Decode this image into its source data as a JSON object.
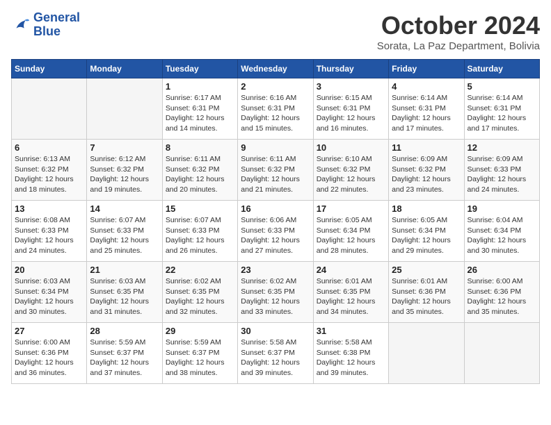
{
  "header": {
    "logo_line1": "General",
    "logo_line2": "Blue",
    "month_title": "October 2024",
    "subtitle": "Sorata, La Paz Department, Bolivia"
  },
  "weekdays": [
    "Sunday",
    "Monday",
    "Tuesday",
    "Wednesday",
    "Thursday",
    "Friday",
    "Saturday"
  ],
  "weeks": [
    [
      {
        "day": "",
        "sunrise": "",
        "sunset": "",
        "daylight": ""
      },
      {
        "day": "",
        "sunrise": "",
        "sunset": "",
        "daylight": ""
      },
      {
        "day": "1",
        "sunrise": "Sunrise: 6:17 AM",
        "sunset": "Sunset: 6:31 PM",
        "daylight": "Daylight: 12 hours and 14 minutes."
      },
      {
        "day": "2",
        "sunrise": "Sunrise: 6:16 AM",
        "sunset": "Sunset: 6:31 PM",
        "daylight": "Daylight: 12 hours and 15 minutes."
      },
      {
        "day": "3",
        "sunrise": "Sunrise: 6:15 AM",
        "sunset": "Sunset: 6:31 PM",
        "daylight": "Daylight: 12 hours and 16 minutes."
      },
      {
        "day": "4",
        "sunrise": "Sunrise: 6:14 AM",
        "sunset": "Sunset: 6:31 PM",
        "daylight": "Daylight: 12 hours and 17 minutes."
      },
      {
        "day": "5",
        "sunrise": "Sunrise: 6:14 AM",
        "sunset": "Sunset: 6:31 PM",
        "daylight": "Daylight: 12 hours and 17 minutes."
      }
    ],
    [
      {
        "day": "6",
        "sunrise": "Sunrise: 6:13 AM",
        "sunset": "Sunset: 6:32 PM",
        "daylight": "Daylight: 12 hours and 18 minutes."
      },
      {
        "day": "7",
        "sunrise": "Sunrise: 6:12 AM",
        "sunset": "Sunset: 6:32 PM",
        "daylight": "Daylight: 12 hours and 19 minutes."
      },
      {
        "day": "8",
        "sunrise": "Sunrise: 6:11 AM",
        "sunset": "Sunset: 6:32 PM",
        "daylight": "Daylight: 12 hours and 20 minutes."
      },
      {
        "day": "9",
        "sunrise": "Sunrise: 6:11 AM",
        "sunset": "Sunset: 6:32 PM",
        "daylight": "Daylight: 12 hours and 21 minutes."
      },
      {
        "day": "10",
        "sunrise": "Sunrise: 6:10 AM",
        "sunset": "Sunset: 6:32 PM",
        "daylight": "Daylight: 12 hours and 22 minutes."
      },
      {
        "day": "11",
        "sunrise": "Sunrise: 6:09 AM",
        "sunset": "Sunset: 6:32 PM",
        "daylight": "Daylight: 12 hours and 23 minutes."
      },
      {
        "day": "12",
        "sunrise": "Sunrise: 6:09 AM",
        "sunset": "Sunset: 6:33 PM",
        "daylight": "Daylight: 12 hours and 24 minutes."
      }
    ],
    [
      {
        "day": "13",
        "sunrise": "Sunrise: 6:08 AM",
        "sunset": "Sunset: 6:33 PM",
        "daylight": "Daylight: 12 hours and 24 minutes."
      },
      {
        "day": "14",
        "sunrise": "Sunrise: 6:07 AM",
        "sunset": "Sunset: 6:33 PM",
        "daylight": "Daylight: 12 hours and 25 minutes."
      },
      {
        "day": "15",
        "sunrise": "Sunrise: 6:07 AM",
        "sunset": "Sunset: 6:33 PM",
        "daylight": "Daylight: 12 hours and 26 minutes."
      },
      {
        "day": "16",
        "sunrise": "Sunrise: 6:06 AM",
        "sunset": "Sunset: 6:33 PM",
        "daylight": "Daylight: 12 hours and 27 minutes."
      },
      {
        "day": "17",
        "sunrise": "Sunrise: 6:05 AM",
        "sunset": "Sunset: 6:34 PM",
        "daylight": "Daylight: 12 hours and 28 minutes."
      },
      {
        "day": "18",
        "sunrise": "Sunrise: 6:05 AM",
        "sunset": "Sunset: 6:34 PM",
        "daylight": "Daylight: 12 hours and 29 minutes."
      },
      {
        "day": "19",
        "sunrise": "Sunrise: 6:04 AM",
        "sunset": "Sunset: 6:34 PM",
        "daylight": "Daylight: 12 hours and 30 minutes."
      }
    ],
    [
      {
        "day": "20",
        "sunrise": "Sunrise: 6:03 AM",
        "sunset": "Sunset: 6:34 PM",
        "daylight": "Daylight: 12 hours and 30 minutes."
      },
      {
        "day": "21",
        "sunrise": "Sunrise: 6:03 AM",
        "sunset": "Sunset: 6:35 PM",
        "daylight": "Daylight: 12 hours and 31 minutes."
      },
      {
        "day": "22",
        "sunrise": "Sunrise: 6:02 AM",
        "sunset": "Sunset: 6:35 PM",
        "daylight": "Daylight: 12 hours and 32 minutes."
      },
      {
        "day": "23",
        "sunrise": "Sunrise: 6:02 AM",
        "sunset": "Sunset: 6:35 PM",
        "daylight": "Daylight: 12 hours and 33 minutes."
      },
      {
        "day": "24",
        "sunrise": "Sunrise: 6:01 AM",
        "sunset": "Sunset: 6:35 PM",
        "daylight": "Daylight: 12 hours and 34 minutes."
      },
      {
        "day": "25",
        "sunrise": "Sunrise: 6:01 AM",
        "sunset": "Sunset: 6:36 PM",
        "daylight": "Daylight: 12 hours and 35 minutes."
      },
      {
        "day": "26",
        "sunrise": "Sunrise: 6:00 AM",
        "sunset": "Sunset: 6:36 PM",
        "daylight": "Daylight: 12 hours and 35 minutes."
      }
    ],
    [
      {
        "day": "27",
        "sunrise": "Sunrise: 6:00 AM",
        "sunset": "Sunset: 6:36 PM",
        "daylight": "Daylight: 12 hours and 36 minutes."
      },
      {
        "day": "28",
        "sunrise": "Sunrise: 5:59 AM",
        "sunset": "Sunset: 6:37 PM",
        "daylight": "Daylight: 12 hours and 37 minutes."
      },
      {
        "day": "29",
        "sunrise": "Sunrise: 5:59 AM",
        "sunset": "Sunset: 6:37 PM",
        "daylight": "Daylight: 12 hours and 38 minutes."
      },
      {
        "day": "30",
        "sunrise": "Sunrise: 5:58 AM",
        "sunset": "Sunset: 6:37 PM",
        "daylight": "Daylight: 12 hours and 39 minutes."
      },
      {
        "day": "31",
        "sunrise": "Sunrise: 5:58 AM",
        "sunset": "Sunset: 6:38 PM",
        "daylight": "Daylight: 12 hours and 39 minutes."
      },
      {
        "day": "",
        "sunrise": "",
        "sunset": "",
        "daylight": ""
      },
      {
        "day": "",
        "sunrise": "",
        "sunset": "",
        "daylight": ""
      }
    ]
  ]
}
